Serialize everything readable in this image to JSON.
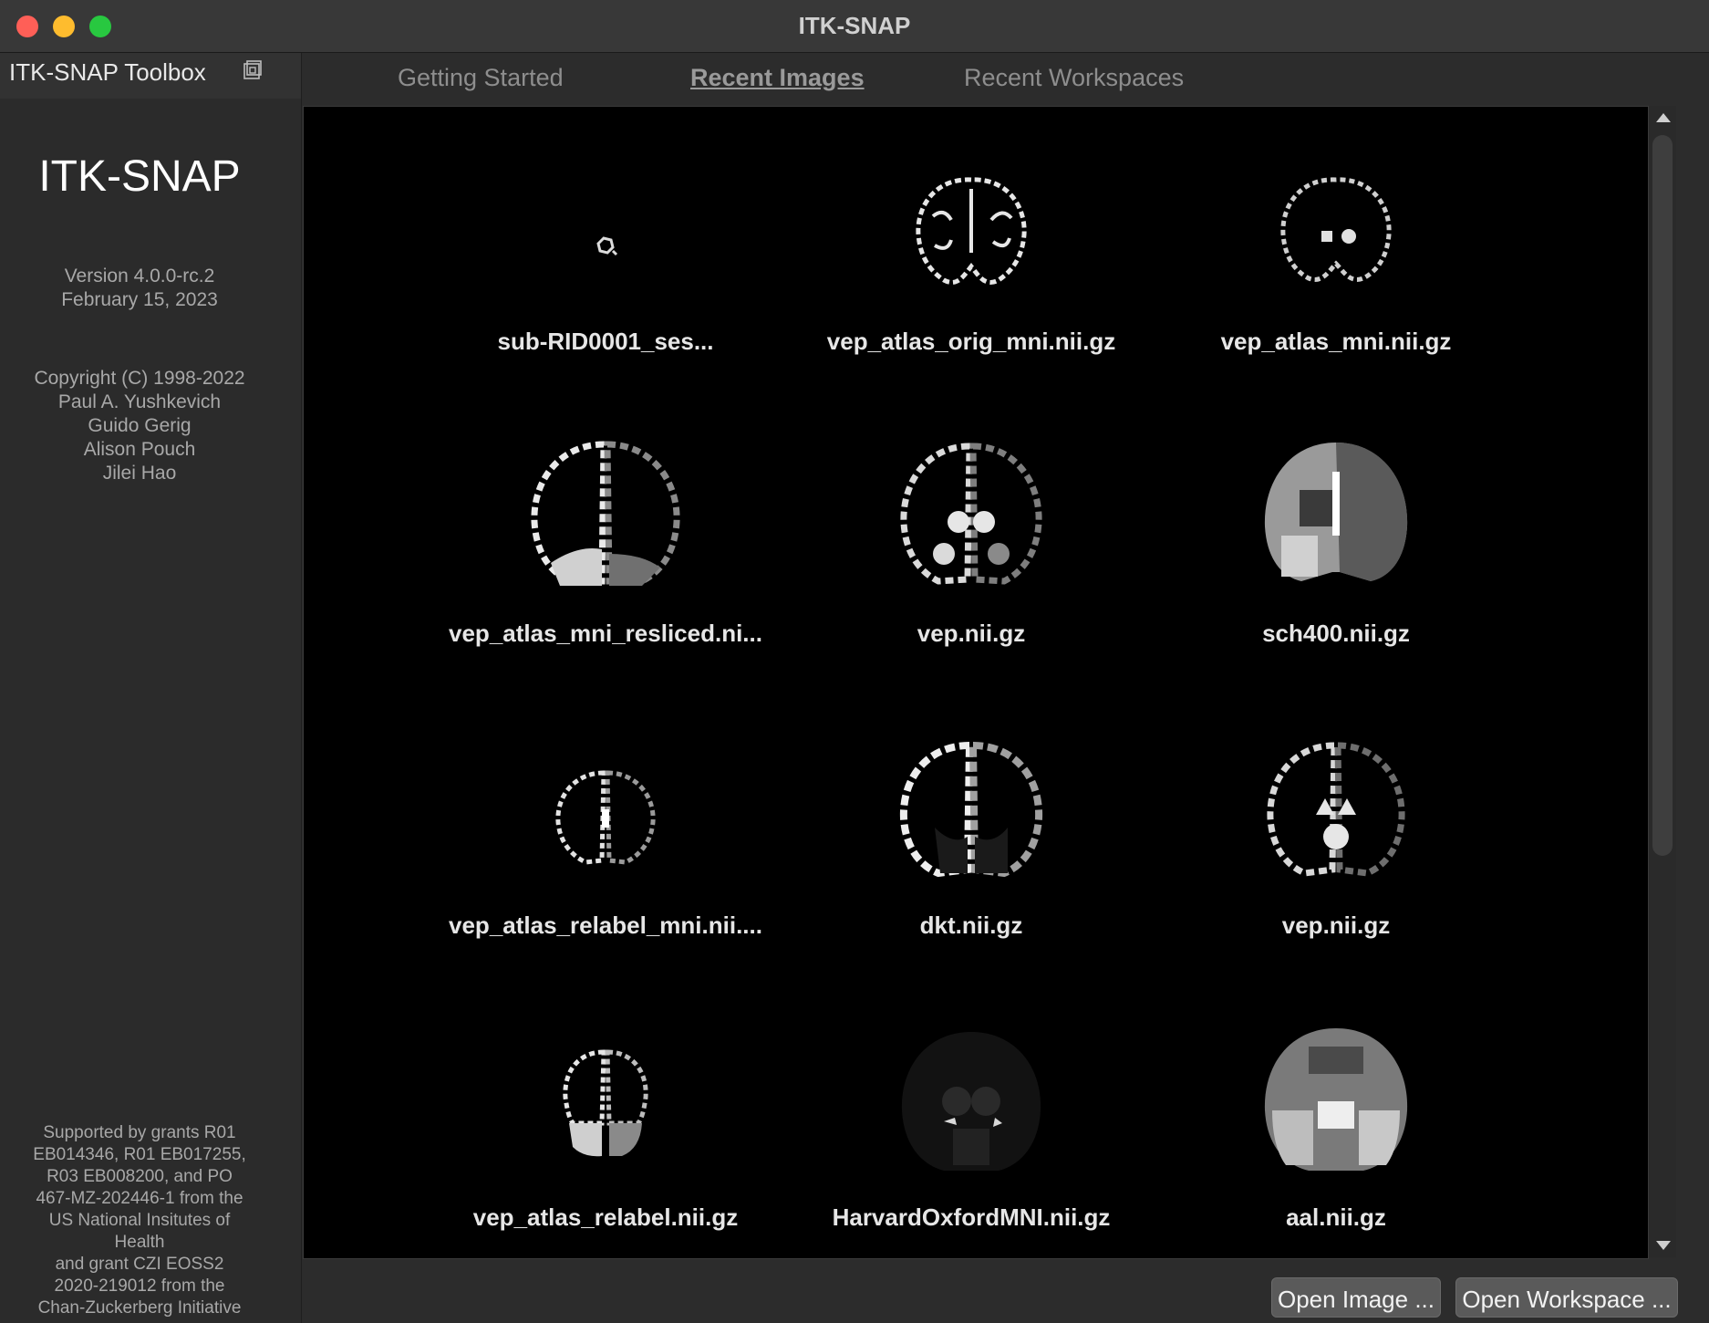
{
  "window": {
    "title": "ITK-SNAP"
  },
  "sidebar": {
    "toolbox_title": "ITK-SNAP Toolbox",
    "app_name": "ITK-SNAP",
    "version": "Version 4.0.0-rc.2",
    "date": "February 15, 2023",
    "copyright": [
      "Copyright (C) 1998-2022",
      "Paul A. Yushkevich",
      "Guido Gerig",
      "Alison Pouch",
      "Jilei Hao"
    ],
    "grants": [
      "Supported by grants R01",
      "EB014346, R01 EB017255,",
      "R03 EB008200, and PO",
      "467-MZ-202446-1 from the",
      "US National Insitutes of",
      "Health",
      "and grant CZI EOSS2",
      "2020-219012 from the",
      "Chan-Zuckerberg Initiative"
    ]
  },
  "tabs": [
    {
      "label": "Getting Started"
    },
    {
      "label": "Recent Images"
    },
    {
      "label": "Recent Workspaces"
    }
  ],
  "images": [
    {
      "label": "sub-RID0001_ses...",
      "icon": "brain-scan-icon"
    },
    {
      "label": "vep_atlas_orig_mni.nii.gz",
      "icon": "brain-scan-icon"
    },
    {
      "label": "vep_atlas_mni.nii.gz",
      "icon": "brain-scan-icon"
    },
    {
      "label": "vep_atlas_mni_resliced.ni...",
      "icon": "brain-scan-icon"
    },
    {
      "label": "vep.nii.gz",
      "icon": "brain-scan-icon"
    },
    {
      "label": "sch400.nii.gz",
      "icon": "brain-scan-icon"
    },
    {
      "label": "vep_atlas_relabel_mni.nii....",
      "icon": "brain-scan-icon"
    },
    {
      "label": "dkt.nii.gz",
      "icon": "brain-scan-icon"
    },
    {
      "label": "vep.nii.gz",
      "icon": "brain-scan-icon"
    },
    {
      "label": "vep_atlas_relabel.nii.gz",
      "icon": "brain-scan-icon"
    },
    {
      "label": "HarvardOxfordMNI.nii.gz",
      "icon": "brain-scan-icon"
    },
    {
      "label": "aal.nii.gz",
      "icon": "brain-scan-icon"
    }
  ],
  "buttons": {
    "open_image": "Open Image ...",
    "open_workspace": "Open Workspace ..."
  }
}
